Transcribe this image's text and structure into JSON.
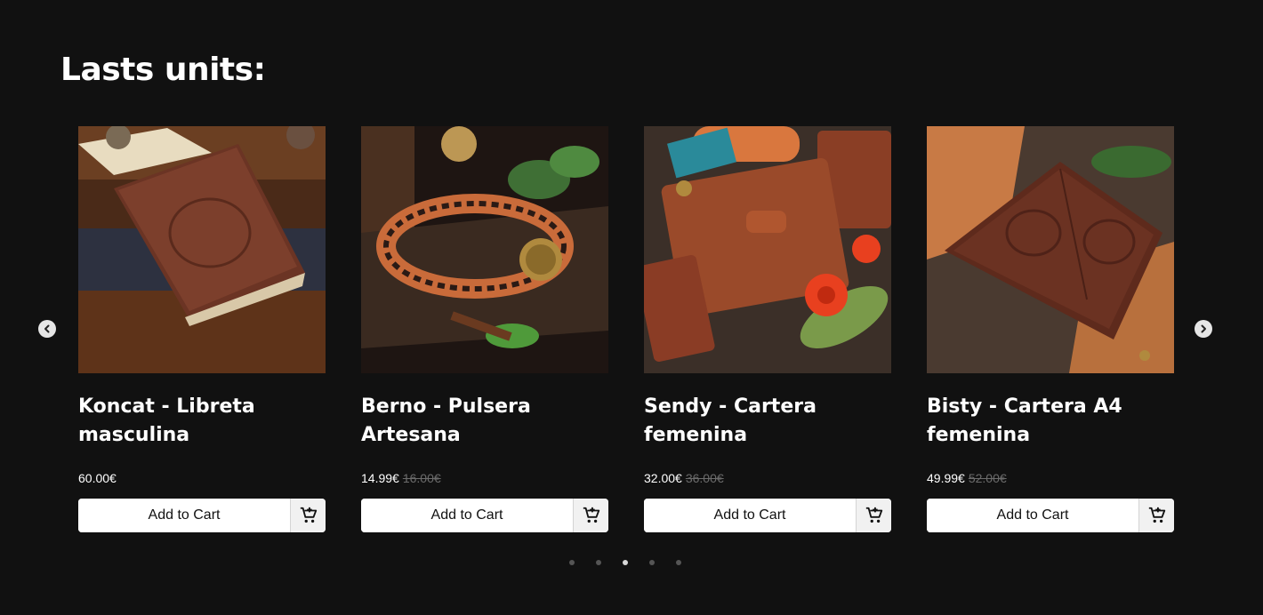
{
  "section": {
    "title": "Lasts units:"
  },
  "carousel": {
    "prev_icon": "chevron-left-icon",
    "next_icon": "chevron-right-icon",
    "active_dot": 2,
    "dot_count": 5
  },
  "products": [
    {
      "name": "Koncat - Libreta masculina",
      "price": "60.00€",
      "old_price": "",
      "button": "Add to Cart",
      "image": "leather-notebook"
    },
    {
      "name": "Berno - Pulsera Artesana",
      "price": "14.99€",
      "old_price": "16.00€",
      "button": "Add to Cart",
      "image": "braided-leather-bracelet"
    },
    {
      "name": "Sendy - Cartera femenina",
      "price": "32.00€",
      "old_price": "36.00€",
      "button": "Add to Cart",
      "image": "leather-wallet-flowers"
    },
    {
      "name": "Bisty - Cartera A4 femenina",
      "price": "49.99€",
      "old_price": "52.00€",
      "button": "Add to Cart",
      "image": "embossed-leather-wallet"
    }
  ]
}
